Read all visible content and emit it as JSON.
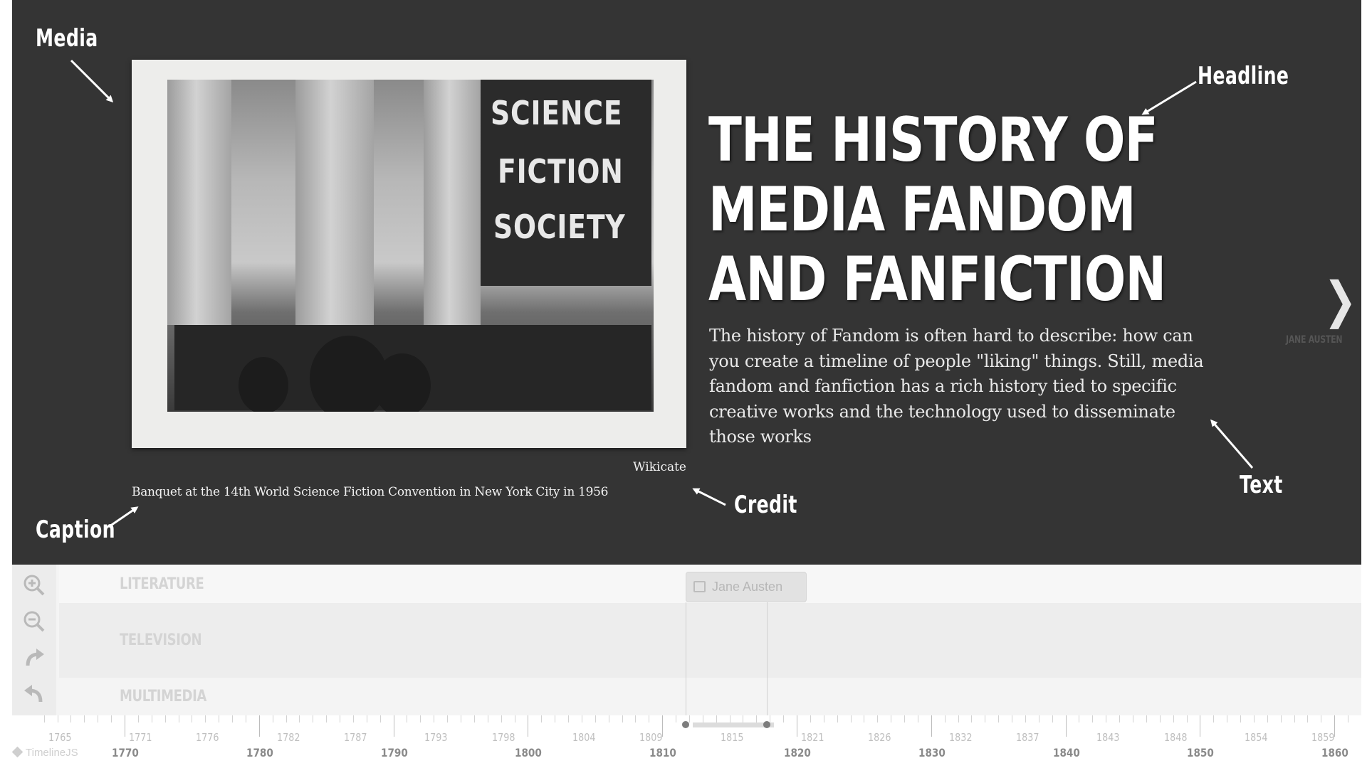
{
  "annotations": {
    "media": "Media",
    "headline": "Headline",
    "text": "Text",
    "credit": "Credit",
    "caption": "Caption"
  },
  "slide": {
    "media_credit": "Wikicate",
    "media_caption": "Banquet at the 14th World Science Fiction Convention in New York City in 1956",
    "banner_lines": [
      "SCIENCE",
      "FICTION",
      "SOCIETY"
    ],
    "headline_lines": [
      "THE HISTORY OF",
      "MEDIA FANDOM",
      "AND FANFICTION"
    ],
    "text": "The history of Fandom is often hard to describe: how can you create a timeline of people \"liking\" things. Still, media fandom and fanfiction has a rich history tied to specific creative works and the technology used to disseminate those works",
    "next_label": "JANE AUSTEN"
  },
  "timenav": {
    "groups": [
      "LITERATURE",
      "TELEVISION",
      "MULTIMEDIA"
    ],
    "marker_label": "Jane Austen",
    "tools": [
      "zoom-in-icon",
      "zoom-out-icon",
      "redo-icon",
      "undo-icon"
    ],
    "brand": "TimelineJS",
    "minor_years": [
      "1765",
      "1771",
      "1776",
      "1782",
      "1787",
      "1793",
      "1798",
      "1804",
      "1809",
      "1815",
      "1821",
      "1826",
      "1832",
      "1837",
      "1843",
      "1848",
      "1854",
      "1859"
    ],
    "major_years": [
      "1770",
      "1780",
      "1790",
      "1800",
      "1810",
      "1820",
      "1830",
      "1840",
      "1850",
      "1860"
    ]
  },
  "colors": {
    "slide_bg": "#343434",
    "timenav_bg": "#f4f4f4",
    "annotation": "#ffffff"
  }
}
